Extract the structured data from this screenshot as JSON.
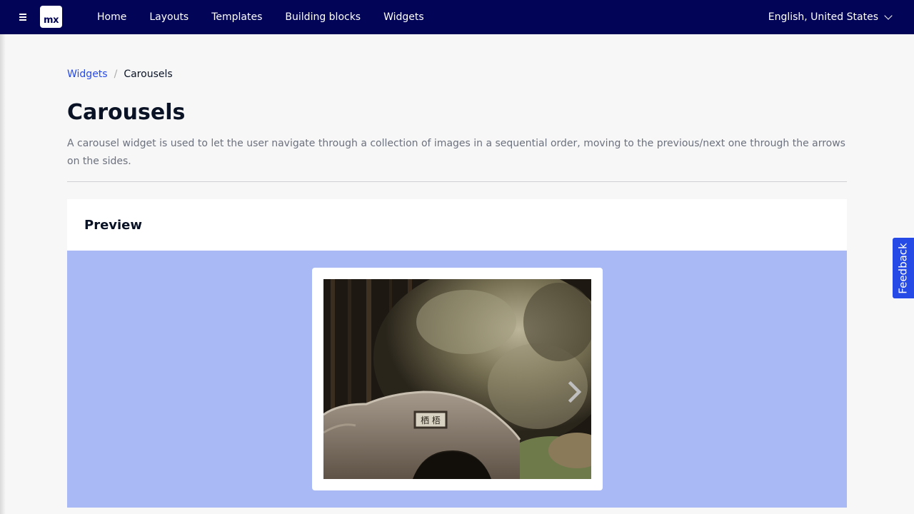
{
  "topbar": {
    "logo_text": "mx",
    "nav": [
      "Home",
      "Layouts",
      "Templates",
      "Building blocks",
      "Widgets"
    ],
    "language": "English, United States"
  },
  "breadcrumb": {
    "parent": "Widgets",
    "separator": "/",
    "current": "Carousels"
  },
  "page": {
    "title": "Carousels",
    "description": "A carousel widget is used to let the user navigate through a collection of images in a sequential order, moving to the previous/next one through the arrows on the sides."
  },
  "preview": {
    "header": "Preview"
  },
  "feedback": {
    "label": "Feedback"
  },
  "colors": {
    "topbar": "#020557",
    "link": "#264ae5",
    "preview_bg": "#a9b9f5",
    "feedback_bg": "#264ae5"
  }
}
